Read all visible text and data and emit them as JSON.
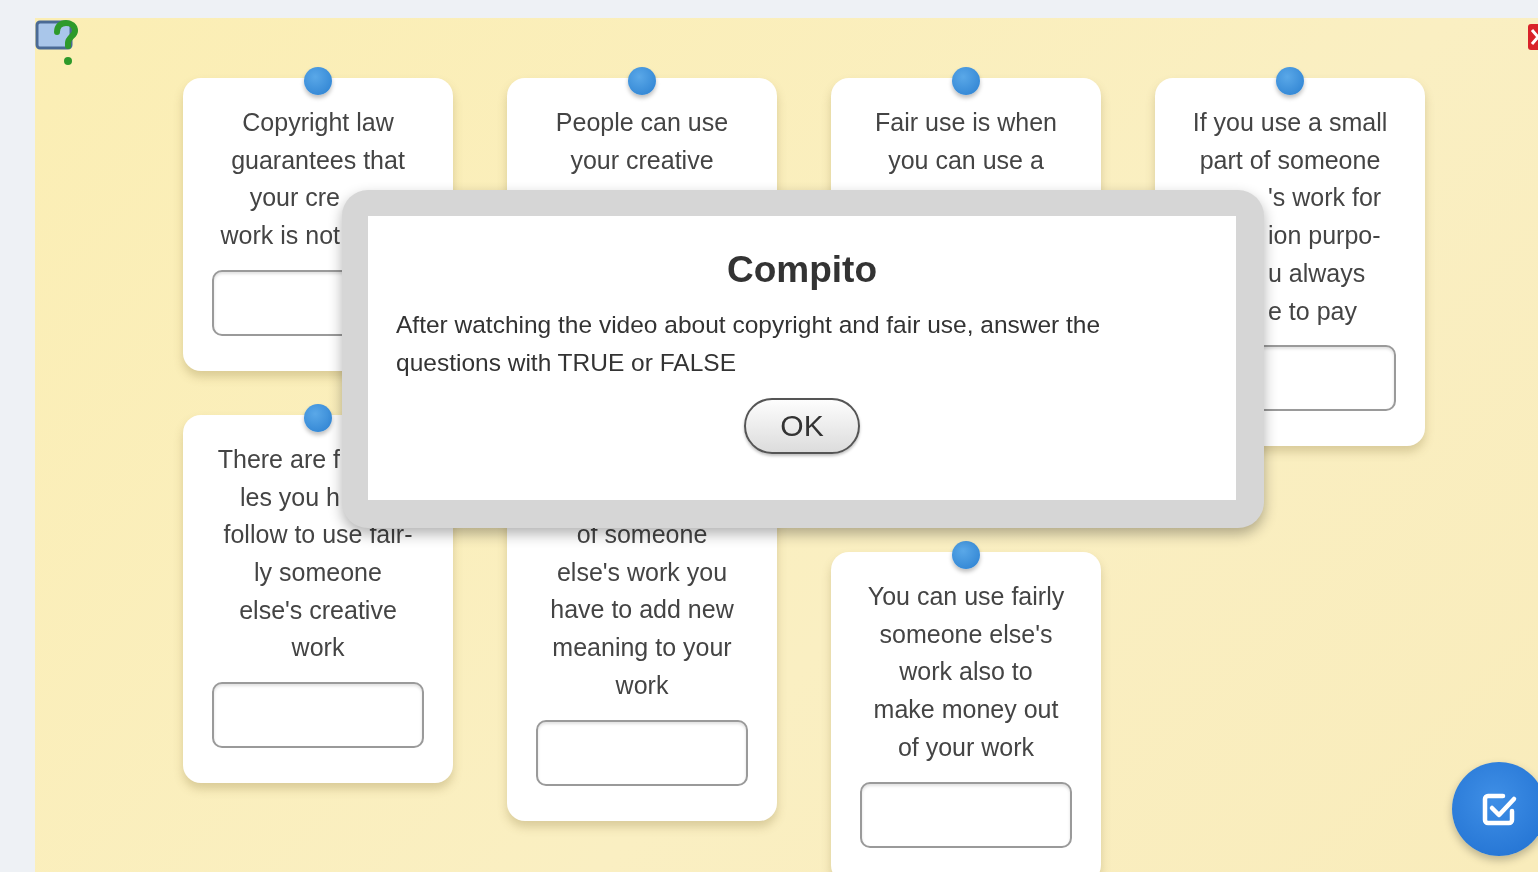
{
  "columns": [
    {
      "cards": [
        {
          "lines": [
            {
              "text": "Copyright law",
              "cut": false
            },
            {
              "text": "guarantees that",
              "cut": false
            },
            {
              "text": "your cre",
              "cut": true
            },
            {
              "text": "work is not",
              "cut": true
            }
          ]
        },
        {
          "lines": [
            {
              "text": "There are f",
              "cut": true
            },
            {
              "text": "les you h",
              "cut": true
            },
            {
              "text": "follow to use fair-",
              "cut": false
            },
            {
              "text": "ly someone",
              "cut": false
            },
            {
              "text": "else's creative",
              "cut": false
            },
            {
              "text": "work",
              "cut": false
            }
          ]
        }
      ]
    },
    {
      "cards": [
        {
          "lines": [
            {
              "text": "People can use",
              "cut": false
            },
            {
              "text": "your creative",
              "cut": false
            }
          ]
        },
        {
          "lines": [
            {
              "text": "of someone",
              "cut": false
            },
            {
              "text": "else's work you",
              "cut": false
            },
            {
              "text": "have to add new",
              "cut": false
            },
            {
              "text": "meaning to your",
              "cut": false
            },
            {
              "text": "work",
              "cut": false
            }
          ]
        }
      ]
    },
    {
      "cards": [
        {
          "lines": [
            {
              "text": "Fair use is when",
              "cut": false
            },
            {
              "text": "you can use a",
              "cut": false
            }
          ]
        },
        {
          "lines": [
            {
              "text": "You can use fairly",
              "cut": false
            },
            {
              "text": "someone else's",
              "cut": false
            },
            {
              "text": "work also to",
              "cut": false
            },
            {
              "text": "make money out",
              "cut": false
            },
            {
              "text": "of your work",
              "cut": false
            }
          ]
        }
      ]
    },
    {
      "cards": [
        {
          "lines": [
            {
              "text": "If you use a small",
              "cut": false
            },
            {
              "text": "part of someone",
              "cut": false
            },
            {
              "text": "'s work for",
              "cut": true
            },
            {
              "text": "ion purpo-",
              "cut": true
            },
            {
              "text": "u always",
              "cut": true
            },
            {
              "text": "e to pay",
              "cut": true
            }
          ]
        }
      ]
    }
  ],
  "dialog": {
    "title": "Compito",
    "message": "After watching the video about copyright and fair use, answer the questions with TRUE or FALSE",
    "button": "OK"
  }
}
